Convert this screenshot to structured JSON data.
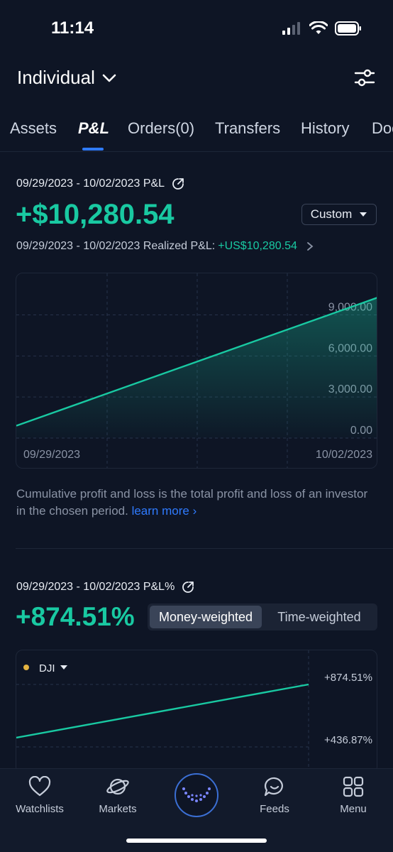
{
  "status": {
    "time": "11:14"
  },
  "header": {
    "account": "Individual"
  },
  "tabs": [
    {
      "label": "Assets"
    },
    {
      "label": "P&L"
    },
    {
      "label": "Orders(0)"
    },
    {
      "label": "Transfers"
    },
    {
      "label": "History"
    },
    {
      "label": "Doc"
    }
  ],
  "pnl": {
    "range_label": "09/29/2023 - 10/02/2023 P&L",
    "value": "+$10,280.54",
    "period_select": "Custom",
    "realized_label": "09/29/2023 - 10/02/2023 Realized P&L:",
    "realized_value": "+US$10,280.54"
  },
  "chart_data": [
    {
      "type": "area",
      "x": [
        "09/29/2023",
        "10/02/2023"
      ],
      "series": [
        {
          "values": [
            900,
            10280.54
          ]
        }
      ],
      "y_ticks": [
        "9,000.00",
        "6,000.00",
        "3,000.00",
        "0.00"
      ],
      "ylim": [
        0,
        11000
      ],
      "grid": true,
      "color": "#19c9a2"
    },
    {
      "type": "line",
      "series": [
        {
          "name": "DJI",
          "values": [
            0,
            874.51
          ]
        }
      ],
      "y_ticks": [
        "+874.51%",
        "+436.87%"
      ],
      "grid": true,
      "color": "#19c9a2"
    }
  ],
  "description": {
    "text": "Cumulative profit and loss is the total profit and loss of an investor in the chosen period.",
    "link": "learn more"
  },
  "pct": {
    "range_label": "09/29/2023 - 10/02/2023 P&L%",
    "value": "+874.51%",
    "seg_on": "Money-weighted",
    "seg_off": "Time-weighted",
    "benchmark": "DJI",
    "benchmark_color": "#e3b341"
  },
  "nav": {
    "watchlists": "Watchlists",
    "markets": "Markets",
    "feeds": "Feeds",
    "menu": "Menu"
  },
  "colors": {
    "accent": "#19c9a2",
    "link": "#2f7bff",
    "background": "#0e1525"
  }
}
